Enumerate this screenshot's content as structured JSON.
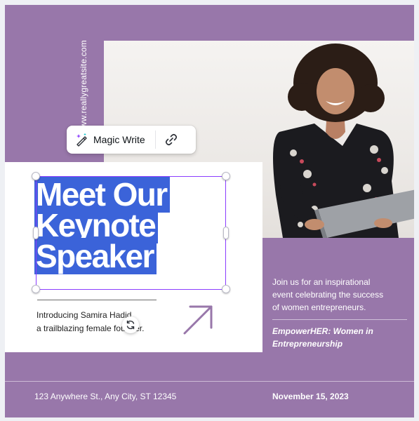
{
  "toolbar": {
    "magic_write_label": "Magic Write",
    "magic_write_icon": "magic-pen-icon",
    "link_icon": "link-icon"
  },
  "design": {
    "website": "www.reallygreatsite.com",
    "headline": [
      "Meet Our",
      "Keynote",
      "Speaker"
    ],
    "intro": [
      "Introducing Samira Hadid,",
      "a trailblazing female founder."
    ],
    "description": [
      "Join us for an inspirational",
      "event celebrating the success",
      "of women entrepreneurs."
    ],
    "event_name": [
      "EmpowerHER: Women in",
      "Entrepreneurship"
    ],
    "address": "123 Anywhere St., Any City, ST 12345",
    "date": "November 15, 2023"
  },
  "colors": {
    "brand_purple": "#9877aa",
    "selection_purple": "#8b3dff",
    "text_highlight": "#3b63d9"
  }
}
